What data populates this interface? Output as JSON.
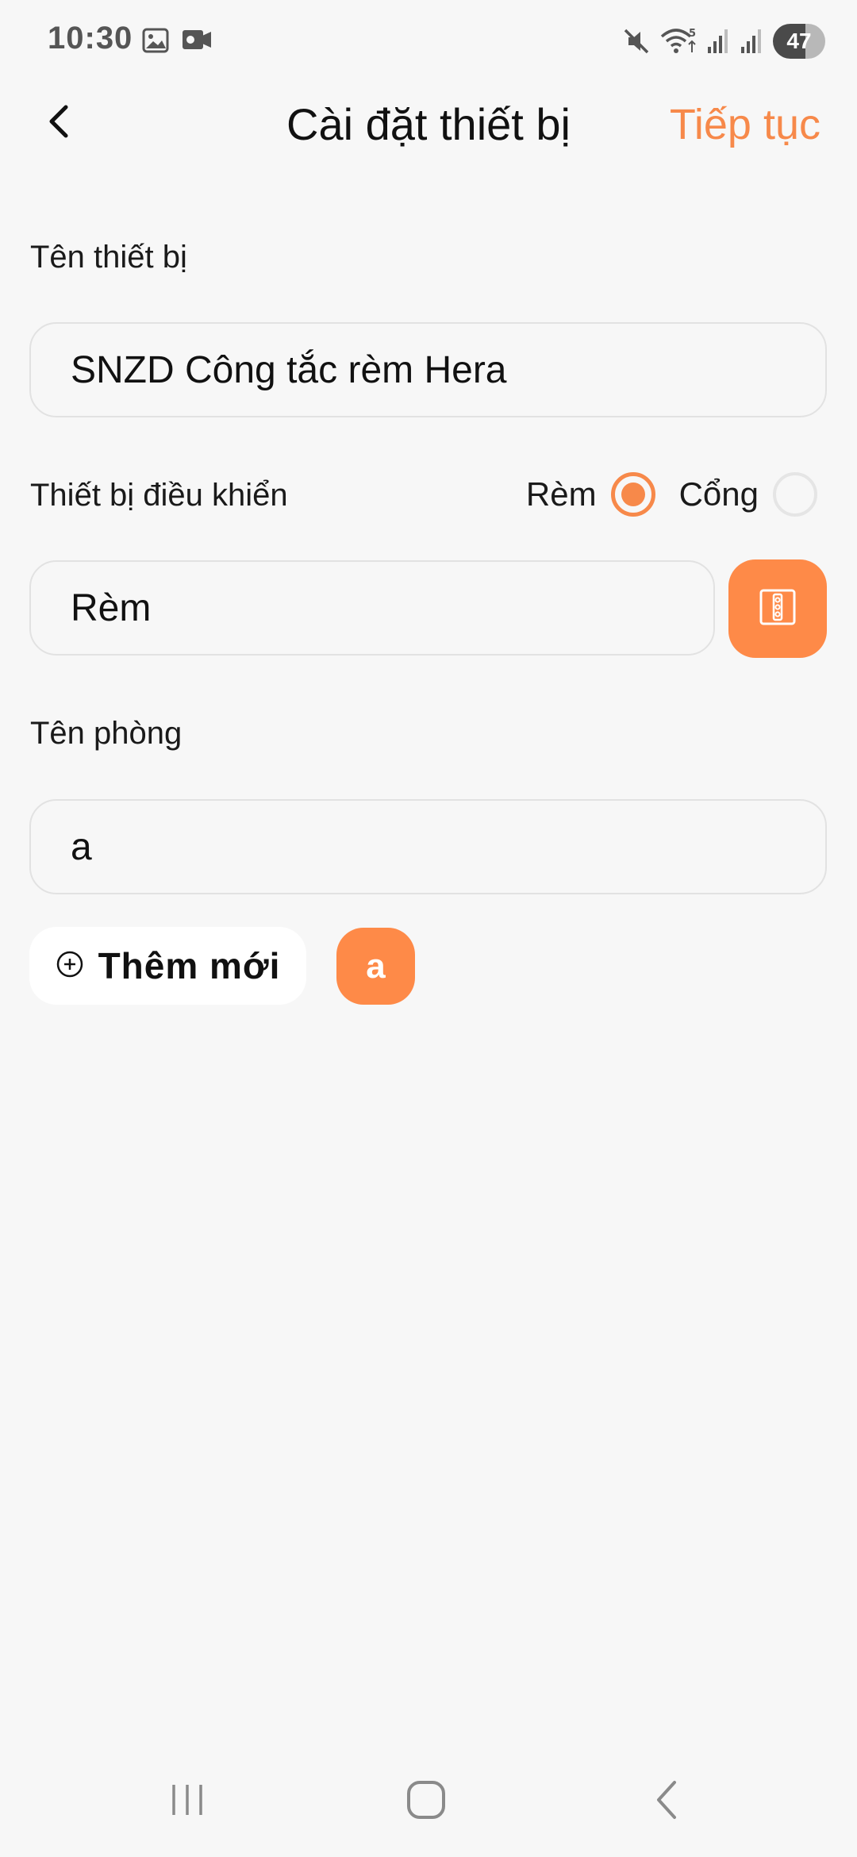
{
  "status_bar": {
    "time": "10:30",
    "battery": "47",
    "icons_left": [
      "gallery-icon",
      "screen-record-icon"
    ],
    "icons_right": [
      "mute-icon",
      "wifi-icon",
      "signal-icon",
      "signal-icon",
      "battery-icon"
    ]
  },
  "header": {
    "title": "Cài đặt thiết bị",
    "continue_label": "Tiếp tục",
    "back_icon": "chevron-left-icon"
  },
  "device_name": {
    "label": "Tên thiết bị",
    "value": "SNZD Công tắc rèm Hera"
  },
  "controlled_device": {
    "label": "Thiết bị điều khiển",
    "options": [
      {
        "label": "Rèm",
        "selected": true
      },
      {
        "label": "Cổng",
        "selected": false
      }
    ],
    "value": "Rèm",
    "icon": "curtain-switch-icon"
  },
  "room": {
    "label": "Tên phòng",
    "value": "a",
    "add_new_label": "Thêm mới",
    "chips": [
      "a"
    ]
  },
  "colors": {
    "accent": "#f7894a",
    "accent_fill": "#fe8a48",
    "background": "#f7f7f7"
  }
}
